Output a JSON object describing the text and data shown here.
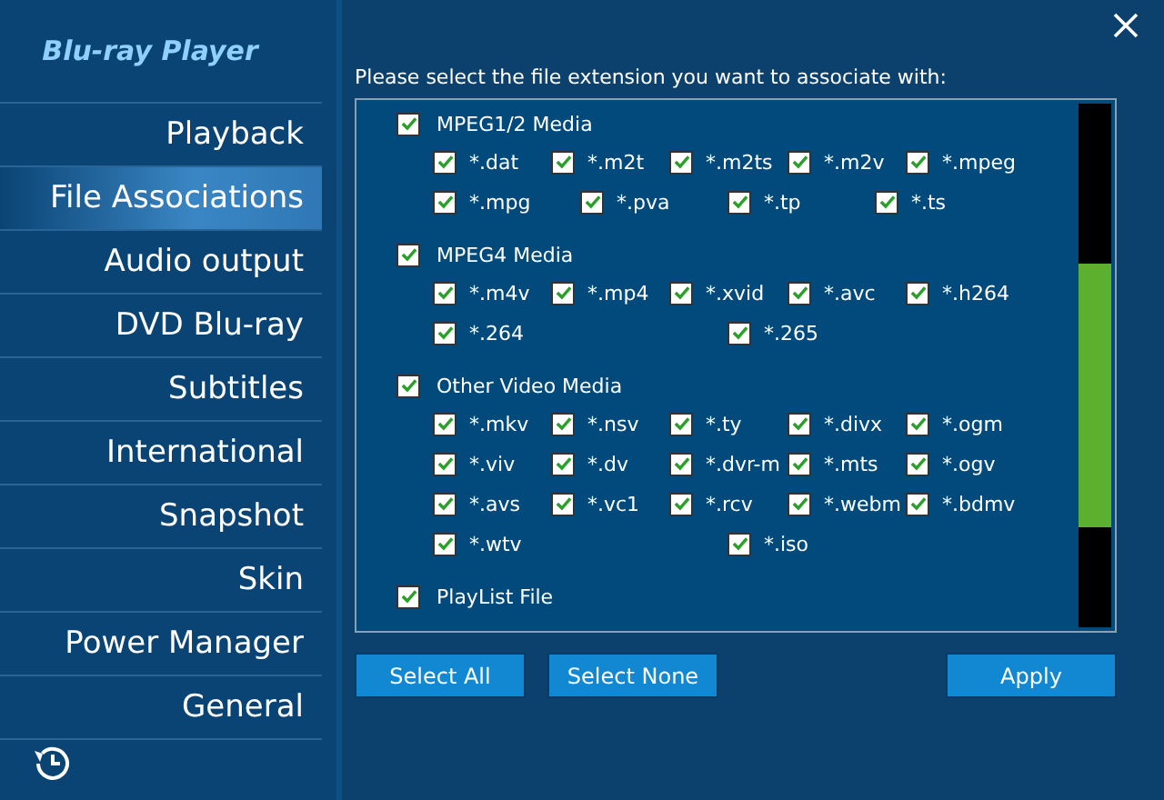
{
  "logo": "Blu-ray Player",
  "sidebar": {
    "items": [
      {
        "label": "Playback",
        "selected": false
      },
      {
        "label": "File Associations",
        "selected": true
      },
      {
        "label": "Audio output",
        "selected": false
      },
      {
        "label": "DVD  Blu-ray",
        "selected": false
      },
      {
        "label": "Subtitles",
        "selected": false
      },
      {
        "label": "International",
        "selected": false
      },
      {
        "label": "Snapshot",
        "selected": false
      },
      {
        "label": "Skin",
        "selected": false
      },
      {
        "label": "Power Manager",
        "selected": false
      },
      {
        "label": "General",
        "selected": false
      }
    ]
  },
  "prompt": "Please select the file extension you want to associate with:",
  "groups": [
    {
      "label": "MPEG1/2 Media",
      "checked": true,
      "rows": [
        [
          {
            "label": "*.dat",
            "checked": true
          },
          {
            "label": "*.m2t",
            "checked": true
          },
          {
            "label": "*.m2ts",
            "checked": true
          },
          {
            "label": "*.m2v",
            "checked": true
          },
          {
            "label": "*.mpeg",
            "checked": true
          }
        ],
        [
          {
            "label": "*.mpg",
            "checked": true
          },
          {
            "label": "*.pva",
            "checked": true
          },
          {
            "label": "*.tp",
            "checked": true
          },
          {
            "label": "*.ts",
            "checked": true
          }
        ]
      ]
    },
    {
      "label": "MPEG4 Media",
      "checked": true,
      "rows": [
        [
          {
            "label": "*.m4v",
            "checked": true
          },
          {
            "label": "*.mp4",
            "checked": true
          },
          {
            "label": "*.xvid",
            "checked": true
          },
          {
            "label": "*.avc",
            "checked": true
          },
          {
            "label": "*.h264",
            "checked": true
          }
        ],
        [
          {
            "label": "*.264",
            "checked": true
          },
          {
            "label": "*.265",
            "checked": true
          }
        ]
      ]
    },
    {
      "label": "Other Video Media",
      "checked": true,
      "rows": [
        [
          {
            "label": "*.mkv",
            "checked": true
          },
          {
            "label": "*.nsv",
            "checked": true
          },
          {
            "label": "*.ty",
            "checked": true
          },
          {
            "label": "*.divx",
            "checked": true
          },
          {
            "label": "*.ogm",
            "checked": true
          }
        ],
        [
          {
            "label": "*.viv",
            "checked": true
          },
          {
            "label": "*.dv",
            "checked": true
          },
          {
            "label": "*.dvr-m",
            "checked": true
          },
          {
            "label": "*.mts",
            "checked": true
          },
          {
            "label": "*.ogv",
            "checked": true
          }
        ],
        [
          {
            "label": "*.avs",
            "checked": true
          },
          {
            "label": "*.vc1",
            "checked": true
          },
          {
            "label": "*.rcv",
            "checked": true
          },
          {
            "label": "*.webm",
            "checked": true
          },
          {
            "label": "*.bdmv",
            "checked": true
          }
        ],
        [
          {
            "label": "*.wtv",
            "checked": true
          },
          {
            "label": "*.iso",
            "checked": true
          }
        ]
      ]
    },
    {
      "label": "PlayList File",
      "checked": true
    }
  ],
  "buttons": [
    "Select All",
    "Select None",
    "Apply"
  ]
}
